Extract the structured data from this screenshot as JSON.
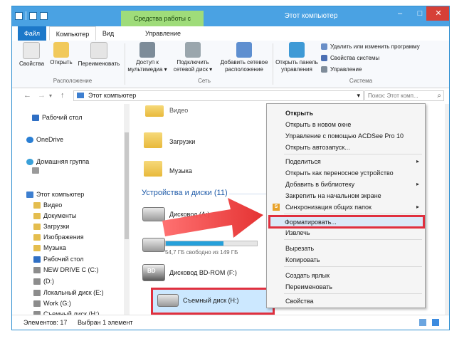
{
  "window": {
    "title": "Этот компьютер",
    "tools_tab": "Средства работы с дисками",
    "minimize": "–",
    "maximize": "□",
    "close": "✕"
  },
  "ribbon_tabs": {
    "file": "Файл",
    "computer": "Компьютер",
    "view": "Вид",
    "manage": "Управление"
  },
  "ribbon": {
    "properties": "Свойства",
    "open": "Открыть",
    "rename": "Переименовать",
    "media_access": "Доступ к мультимедиа ▾",
    "map_drive": "Подключить сетевой диск ▾",
    "add_location": "Добавить сетевое расположение",
    "control_panel": "Открыть панель управления",
    "uninstall": "Удалить или изменить программу",
    "system_props": "Свойства системы",
    "manage": "Управление",
    "group_location": "Расположение",
    "group_network": "Сеть",
    "group_system": "Система"
  },
  "address": {
    "back": "←",
    "forward": "→",
    "recent": "▾",
    "up": "↑",
    "path": "Этот компьютер",
    "dropdown": "▾",
    "refresh": "⟳",
    "search_placeholder": "Поиск: Этот комп...",
    "search_icon": "⌕"
  },
  "nav": {
    "desktop_top": "Рабочий стол",
    "onedrive": "OneDrive",
    "homegroup": "Домашняя группа",
    "this_pc": "Этот компьютер",
    "items": [
      "Видео",
      "Документы",
      "Загрузки",
      "Изображения",
      "Музыка",
      "Рабочий стол",
      "NEW DRIVE C (C:)",
      "(D:)",
      "Локальный диск (E:)",
      "Work (G:)",
      "Съемный диск (H:)"
    ]
  },
  "content": {
    "video_partial": "Видео",
    "downloads": "Загрузки",
    "music": "Музыка",
    "section": "Устройства и диски (11)",
    "drive_a": "Дисковод (A:)",
    "free_space": "54,7 ГБ свободно из 149 ГБ",
    "drive_f": "Дисковод BD-ROM (F:)",
    "drive_h": "Съемный диск (H:)",
    "bd_label": "BD"
  },
  "status": {
    "count": "Элементов: 17",
    "selected": "Выбран 1 элемент"
  },
  "menu": {
    "open": "Открыть",
    "open_new": "Открыть в новом окне",
    "acdsee": "Управление с помощью ACDSee Pro 10",
    "autoplay": "Открыть автозапуск...",
    "share": "Поделиться",
    "portable": "Открыть как переносное устройство",
    "library": "Добавить в библиотеку",
    "pin": "Закрепить на начальном экране",
    "sync": "Синхронизация общих папок",
    "format": "Форматировать...",
    "eject": "Извлечь",
    "cut": "Вырезать",
    "copy": "Копировать",
    "shortcut": "Создать ярлык",
    "rename": "Переименовать",
    "properties": "Свойства",
    "submenu_arrow": "▸",
    "acd_badge": "S"
  },
  "colors": {
    "title_bar": "#4aa2e3",
    "tools_tab": "#9fdc7a",
    "file_tab": "#1c78c9",
    "highlight_red": "#e0303f",
    "selection": "#cce8ff"
  }
}
